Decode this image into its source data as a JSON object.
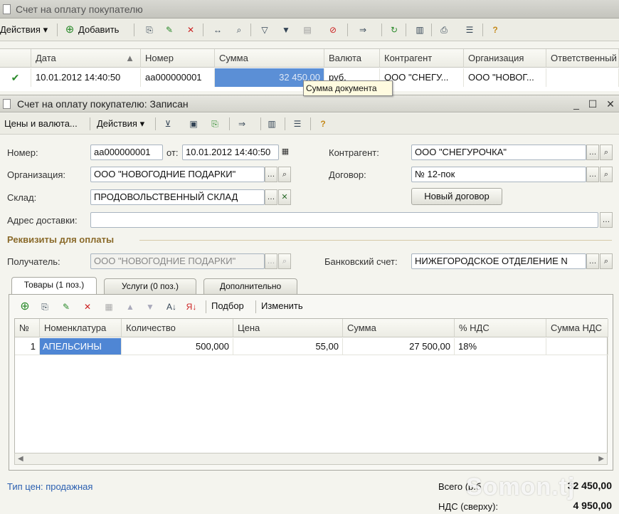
{
  "window": {
    "title": "Счет на оплату покупателю"
  },
  "list_toolbar": {
    "actions": "Действия",
    "add": "Добавить"
  },
  "list_grid": {
    "headers": [
      "Дата",
      "Номер",
      "Сумма",
      "Валюта",
      "Контрагент",
      "Организация",
      "Ответственный"
    ],
    "row": {
      "date": "10.01.2012 14:40:50",
      "number": "аа000000001",
      "sum": "32 450,00",
      "currency": "руб.",
      "counterparty": "ООО \"СНЕГУ...",
      "organization": "ООО \"НОВОГ..."
    }
  },
  "tooltip": "Сумма документа",
  "form": {
    "title": "Счет на оплату покупателю: Записан",
    "toolbar": {
      "prices": "Цены и валюта...",
      "actions": "Действия"
    },
    "number_label": "Номер:",
    "number_value": "аа000000001",
    "from_label": "от:",
    "date_value": "10.01.2012 14:40:50",
    "counterparty_label": "Контрагент:",
    "counterparty_value": "ООО \"СНЕГУРОЧКА\"",
    "org_label": "Организация:",
    "org_value": "ООО \"НОВОГОДНИЕ ПОДАРКИ\"",
    "contract_label": "Договор:",
    "contract_value": "№ 12-пок",
    "warehouse_label": "Склад:",
    "warehouse_value": "ПРОДОВОЛЬСТВЕННЫЙ СКЛАД",
    "new_contract_button": "Новый договор",
    "address_label": "Адрес доставки:",
    "address_value": "",
    "payment_section": "Реквизиты для оплаты",
    "recipient_label": "Получатель:",
    "recipient_value": "ООО \"НОВОГОДНИЕ ПОДАРКИ\"",
    "bank_label": "Банковский счет:",
    "bank_value": "НИЖЕГОРОДСКОЕ ОТДЕЛЕНИЕ N",
    "tabs": [
      "Товары (1 поз.)",
      "Услуги (0 поз.)",
      "Дополнительно"
    ],
    "grid_toolbar": {
      "select": "Подбор",
      "change": "Изменить"
    },
    "goods_headers": [
      "№",
      "Номенклатура",
      "Количество",
      "Цена",
      "Сумма",
      "% НДС",
      "Сумма НДС"
    ],
    "goods_row": {
      "n": "1",
      "item": "АПЕЛЬСИНЫ",
      "qty": "500,000",
      "price": "55,00",
      "sum": "27 500,00",
      "vat": "18%"
    },
    "price_type": "Тип цен: продажная",
    "total_label": "Всего (р.б",
    "total_value": "32 450,00",
    "vat_label": "НДС (сверху):",
    "vat_value": "4 950,00"
  },
  "watermark": "Somon.tj"
}
